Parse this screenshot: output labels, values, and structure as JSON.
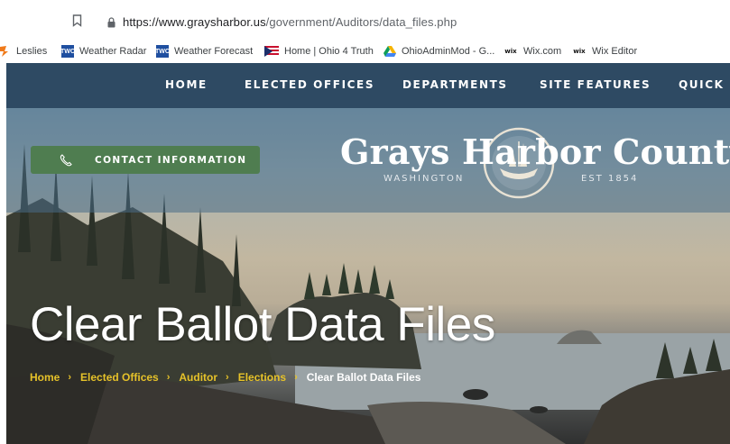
{
  "browser": {
    "url_host": "https://www.graysharbor.us",
    "url_path": "/government/Auditors/data_files.php",
    "bookmarks": [
      {
        "label": "Leslies",
        "icon": "leslies-favicon"
      },
      {
        "label": "Weather Radar",
        "icon": "weather-favicon"
      },
      {
        "label": "Weather Forecast",
        "icon": "weather-favicon"
      },
      {
        "label": "Home | Ohio 4 Truth",
        "icon": "flag-favicon"
      },
      {
        "label": "OhioAdminMod - G...",
        "icon": "google-drive-favicon"
      },
      {
        "label": "Wix.com",
        "icon": "wix-favicon"
      },
      {
        "label": "Wix Editor",
        "icon": "wix-favicon"
      }
    ],
    "wix_mark": "wix",
    "weather_mark": "TWC"
  },
  "nav": {
    "items": [
      "HOME",
      "ELECTED OFFICES",
      "DEPARTMENTS",
      "SITE FEATURES",
      "QUICK L"
    ]
  },
  "header": {
    "contact_label": "CONTACT INFORMATION",
    "site_title": "Grays Harbor County",
    "site_sub_left": "WASHINGTON",
    "site_sub_right": "EST 1854"
  },
  "page": {
    "title": "Clear Ballot Data Files",
    "breadcrumbs": [
      "Home",
      "Elected Offices",
      "Auditor",
      "Elections"
    ],
    "breadcrumb_current": "Clear Ballot Data Files",
    "breadcrumb_separator": "›"
  },
  "colors": {
    "nav_bg": "#2e4a63",
    "contact_bg": "#4f7d50",
    "breadcrumb_link": "#e6c229"
  }
}
